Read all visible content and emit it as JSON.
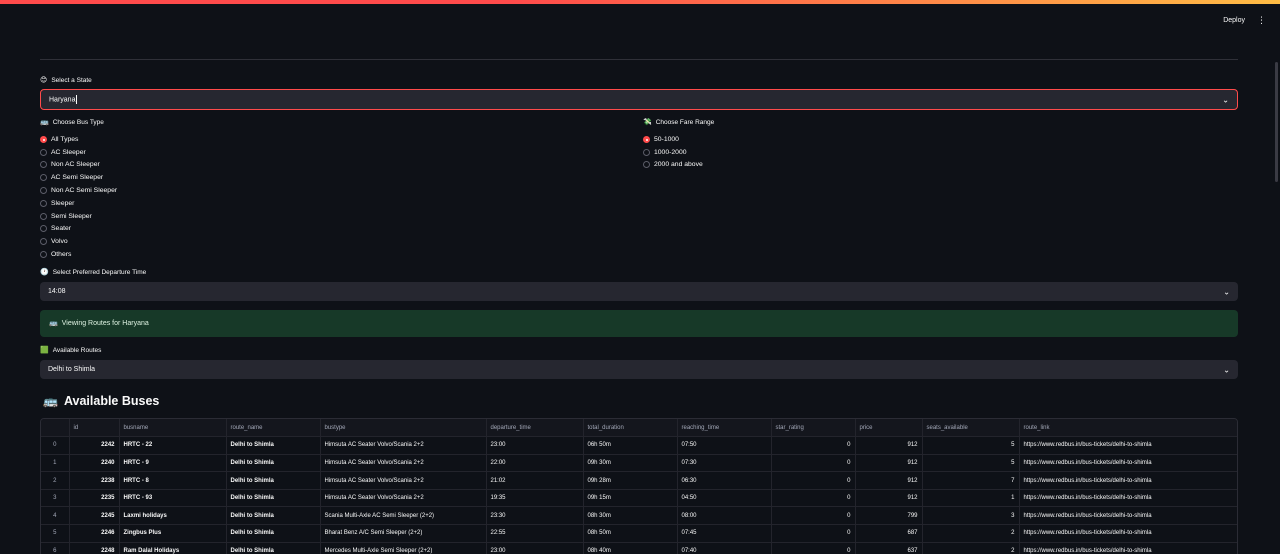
{
  "header": {
    "deploy_label": "Deploy",
    "menu_icon": "⋮"
  },
  "state": {
    "label": "Select a State",
    "emoji": "😊",
    "value": "Haryana"
  },
  "bus_type": {
    "label": "Choose Bus Type",
    "emoji": "🚌",
    "options": [
      "All Types",
      "AC Sleeper",
      "Non AC Sleeper",
      "AC Semi Sleeper",
      "Non AC Semi Sleeper",
      "Sleeper",
      "Semi Sleeper",
      "Seater",
      "Volvo",
      "Others"
    ],
    "selected": "All Types"
  },
  "fare": {
    "label": "Choose Fare Range",
    "emoji": "💸",
    "options": [
      "50-1000",
      "1000-2000",
      "2000 and above"
    ],
    "selected": "50-1000"
  },
  "departure": {
    "label": "Select Preferred Departure Time",
    "emoji": "🕐",
    "value": "14:08"
  },
  "notice": {
    "emoji": "🚌",
    "text": "Viewing Routes for Haryana"
  },
  "routes": {
    "label": "Available Routes",
    "emoji": "🟩",
    "value": "Delhi to Shimla"
  },
  "buses": {
    "title": "Available Buses",
    "emoji": "🚌",
    "columns": [
      "",
      "id",
      "busname",
      "route_name",
      "bustype",
      "departure_time",
      "total_duration",
      "reaching_time",
      "star_rating",
      "price",
      "seats_available",
      "route_link"
    ],
    "rows": [
      [
        "0",
        "2242",
        "HRTC - 22",
        "Delhi to Shimla",
        "Himsuta AC Seater Volvo/Scania 2+2",
        "23:00",
        "06h 50m",
        "07:50",
        "0",
        "912",
        "5",
        "https://www.redbus.in/bus-tickets/delhi-to-shimla"
      ],
      [
        "1",
        "2240",
        "HRTC - 9",
        "Delhi to Shimla",
        "Himsuta AC Seater Volvo/Scania 2+2",
        "22:00",
        "09h 30m",
        "07:30",
        "0",
        "912",
        "5",
        "https://www.redbus.in/bus-tickets/delhi-to-shimla"
      ],
      [
        "2",
        "2238",
        "HRTC - 8",
        "Delhi to Shimla",
        "Himsuta AC Seater Volvo/Scania 2+2",
        "21:02",
        "09h 28m",
        "06:30",
        "0",
        "912",
        "7",
        "https://www.redbus.in/bus-tickets/delhi-to-shimla"
      ],
      [
        "3",
        "2235",
        "HRTC - 93",
        "Delhi to Shimla",
        "Himsuta AC Seater Volvo/Scania 2+2",
        "19:35",
        "09h 15m",
        "04:50",
        "0",
        "912",
        "1",
        "https://www.redbus.in/bus-tickets/delhi-to-shimla"
      ],
      [
        "4",
        "2245",
        "Laxmi holidays",
        "Delhi to Shimla",
        "Scania Multi-Axle AC Semi Sleeper (2+2)",
        "23:30",
        "08h 30m",
        "08:00",
        "0",
        "799",
        "3",
        "https://www.redbus.in/bus-tickets/delhi-to-shimla"
      ],
      [
        "5",
        "2246",
        "Zingbus Plus",
        "Delhi to Shimla",
        "Bharat Benz A/C Semi Sleeper (2+2)",
        "22:55",
        "08h 50m",
        "07:45",
        "0",
        "687",
        "2",
        "https://www.redbus.in/bus-tickets/delhi-to-shimla"
      ],
      [
        "6",
        "2248",
        "Ram Dalal Holidays",
        "Delhi to Shimla",
        "Mercedes Multi-Axle Semi Sleeper (2+2)",
        "23:00",
        "08h 40m",
        "07:40",
        "0",
        "637",
        "2",
        "https://www.redbus.in/bus-tickets/delhi-to-shimla"
      ]
    ]
  }
}
